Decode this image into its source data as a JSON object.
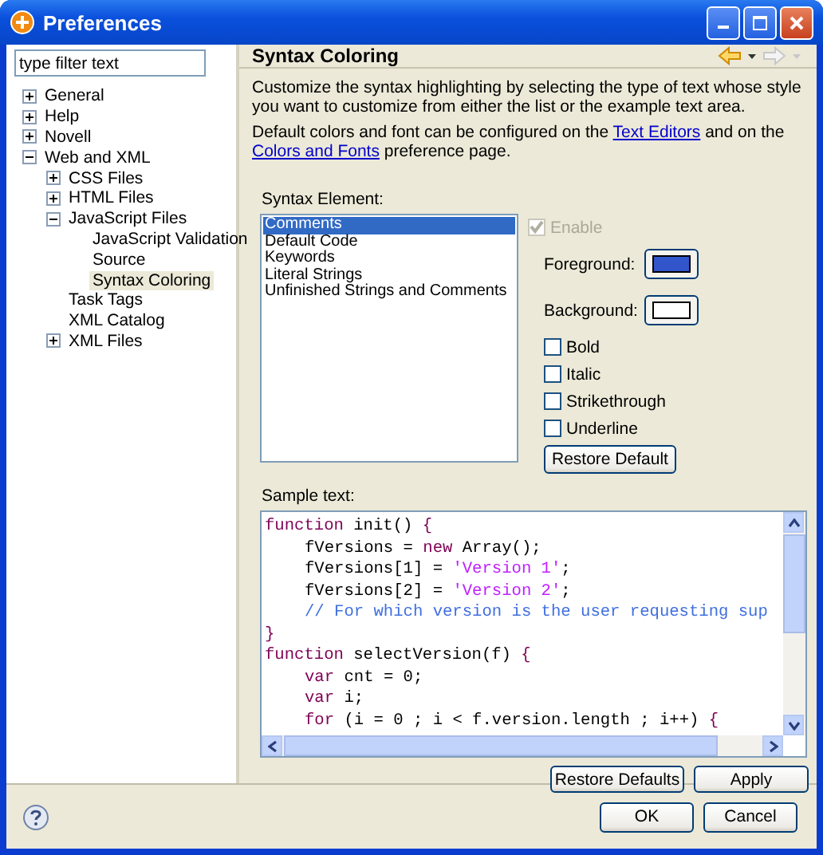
{
  "window": {
    "title": "Preferences"
  },
  "filter": {
    "value": "type filter text"
  },
  "tree": [
    {
      "label": "General",
      "expanded": false,
      "selected": false
    },
    {
      "label": "Help",
      "expanded": false,
      "selected": false
    },
    {
      "label": "Novell",
      "expanded": false,
      "selected": false
    },
    {
      "label": "Web and XML",
      "expanded": true,
      "selected": false,
      "children": [
        {
          "label": "CSS Files",
          "expanded": false,
          "selected": false
        },
        {
          "label": "HTML Files",
          "expanded": false,
          "selected": false
        },
        {
          "label": "JavaScript Files",
          "expanded": true,
          "selected": false,
          "children": [
            {
              "label": "JavaScript Validation",
              "selected": false
            },
            {
              "label": "Source",
              "selected": false
            },
            {
              "label": "Syntax Coloring",
              "selected": true
            }
          ]
        },
        {
          "label": "Task Tags",
          "selected": false
        },
        {
          "label": "XML Catalog",
          "selected": false
        },
        {
          "label": "XML Files",
          "expanded": false,
          "selected": false
        }
      ]
    }
  ],
  "page": {
    "title": "Syntax Coloring",
    "nav": [
      {
        "kind": "back",
        "disabled": false
      },
      {
        "kind": "forward",
        "disabled": true
      }
    ],
    "description": "Customize the syntax highlighting by selecting the type of text whose style you want to customize from either the list or the example text area.",
    "defaults_note": {
      "before": "Default colors and font can be configured on the ",
      "link1": "Text Editors",
      "middle": " and on the ",
      "link2": "Colors and Fonts",
      "after": " preference page."
    },
    "element_label": "Syntax Element:",
    "elements": [
      {
        "label": "Comments",
        "selected": true
      },
      {
        "label": "Default Code",
        "selected": false
      },
      {
        "label": "Keywords",
        "selected": false
      },
      {
        "label": "Literal Strings",
        "selected": false
      },
      {
        "label": "Unfinished Strings and Comments",
        "selected": false
      }
    ],
    "enable": {
      "label": "Enable",
      "checked": true,
      "disabled": true
    },
    "colors": [
      {
        "label": "Foreground:",
        "color": "#3355cc"
      },
      {
        "label": "Background:",
        "color": "#ffffff"
      }
    ],
    "styles": [
      {
        "label": "Bold",
        "checked": false
      },
      {
        "label": "Italic",
        "checked": false
      },
      {
        "label": "Strikethrough",
        "checked": false
      },
      {
        "label": "Underline",
        "checked": false
      }
    ],
    "restore_default": "Restore Default",
    "sample_label": "Sample text:",
    "sample": [
      {
        "indented": false,
        "tokens": [
          {
            "kind": "keyword",
            "text": "function"
          },
          {
            "kind": "plain",
            "text": " init() "
          },
          {
            "kind": "keyword",
            "text": "{"
          }
        ]
      },
      {
        "indented": true,
        "tokens": [
          {
            "kind": "plain",
            "text": "fVersions = "
          },
          {
            "kind": "keyword",
            "text": "new"
          },
          {
            "kind": "plain",
            "text": " Array();"
          }
        ]
      },
      {
        "indented": true,
        "tokens": [
          {
            "kind": "plain",
            "text": "fVersions[1] = "
          },
          {
            "kind": "string",
            "text": "'Version 1'"
          },
          {
            "kind": "plain",
            "text": ";"
          }
        ]
      },
      {
        "indented": true,
        "tokens": [
          {
            "kind": "plain",
            "text": "fVersions[2] = "
          },
          {
            "kind": "string",
            "text": "'Version 2'"
          },
          {
            "kind": "plain",
            "text": ";"
          }
        ]
      },
      {
        "indented": true,
        "tokens": [
          {
            "kind": "comment",
            "text": "// For which version is the user requesting sup"
          }
        ]
      },
      {
        "indented": false,
        "tokens": [
          {
            "kind": "keyword",
            "text": "}"
          }
        ]
      },
      {
        "indented": false,
        "tokens": [
          {
            "kind": "keyword",
            "text": "function"
          },
          {
            "kind": "plain",
            "text": " selectVersion(f) "
          },
          {
            "kind": "keyword",
            "text": "{"
          }
        ]
      },
      {
        "indented": true,
        "tokens": [
          {
            "kind": "keyword",
            "text": "var"
          },
          {
            "kind": "plain",
            "text": " cnt = 0;"
          }
        ]
      },
      {
        "indented": true,
        "tokens": [
          {
            "kind": "keyword",
            "text": "var"
          },
          {
            "kind": "plain",
            "text": " i;"
          }
        ]
      },
      {
        "indented": true,
        "tokens": [
          {
            "kind": "keyword",
            "text": "for"
          },
          {
            "kind": "plain",
            "text": " (i = 0 ; i < f.version.length ; i++) "
          },
          {
            "kind": "keyword",
            "text": "{"
          }
        ]
      }
    ],
    "buttons": [
      "Restore Defaults",
      "Apply"
    ]
  },
  "dialog_buttons": [
    "OK",
    "Cancel"
  ]
}
